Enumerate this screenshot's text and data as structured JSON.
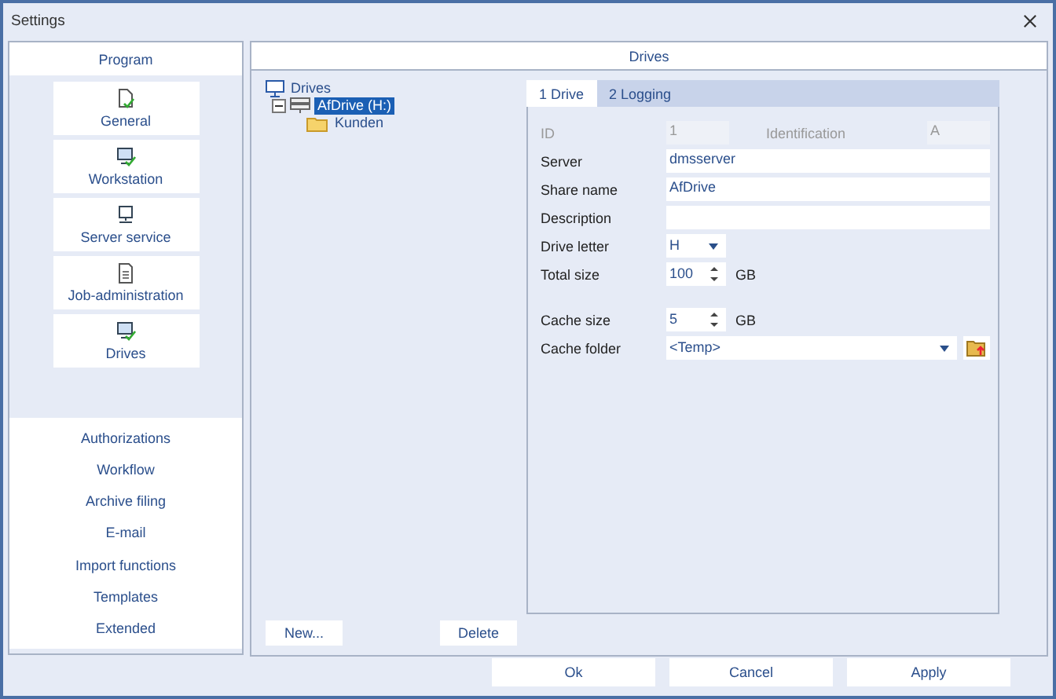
{
  "window": {
    "title": "Settings"
  },
  "sidebar": {
    "header": "Program",
    "program_items": [
      {
        "label": "General"
      },
      {
        "label": "Workstation"
      },
      {
        "label": "Server service"
      },
      {
        "label": "Job-administration"
      },
      {
        "label": "Drives"
      }
    ],
    "sections": [
      "Authorizations",
      "Workflow",
      "Archive filing",
      "E-mail",
      "Import functions",
      "Templates",
      "Extended"
    ]
  },
  "drives_panel": {
    "title": "Drives",
    "tree": [
      {
        "label": "Drives",
        "selected": false,
        "children": [
          {
            "label": "AfDrive (H:)",
            "selected": true,
            "expanded": true,
            "children": [
              {
                "label": "Kunden",
                "selected": false
              }
            ]
          }
        ]
      }
    ],
    "buttons": [
      "New...",
      "Delete"
    ]
  },
  "tabs": [
    {
      "label": "1 Drive",
      "selected": true
    },
    {
      "label": "2 Logging",
      "selected": false
    }
  ],
  "field_groups": [
    [
      {
        "kind": "id",
        "label": "ID",
        "value": "1",
        "disabled": true,
        "second_label": "Identification",
        "second_value": "A"
      },
      {
        "kind": "text",
        "label": "Server",
        "value": "dmsserver",
        "disabled": false
      },
      {
        "kind": "text",
        "label": "Share name",
        "value": "AfDrive",
        "disabled": false
      },
      {
        "kind": "text",
        "label": "Description",
        "disabled": false
      },
      {
        "kind": "dropdown",
        "label": "Drive letter",
        "value": "H",
        "disabled": false
      },
      {
        "kind": "spin",
        "label": "Total size",
        "value": "100",
        "unit": "GB",
        "disabled": false
      }
    ],
    [
      {
        "kind": "spin",
        "label": "Cache size",
        "value": "5",
        "unit": "GB",
        "disabled": false
      },
      {
        "kind": "folder",
        "label": "Cache folder",
        "value": "<Temp>",
        "disabled": false
      }
    ]
  ],
  "footer_buttons": [
    "Ok",
    "Cancel",
    "Apply"
  ]
}
